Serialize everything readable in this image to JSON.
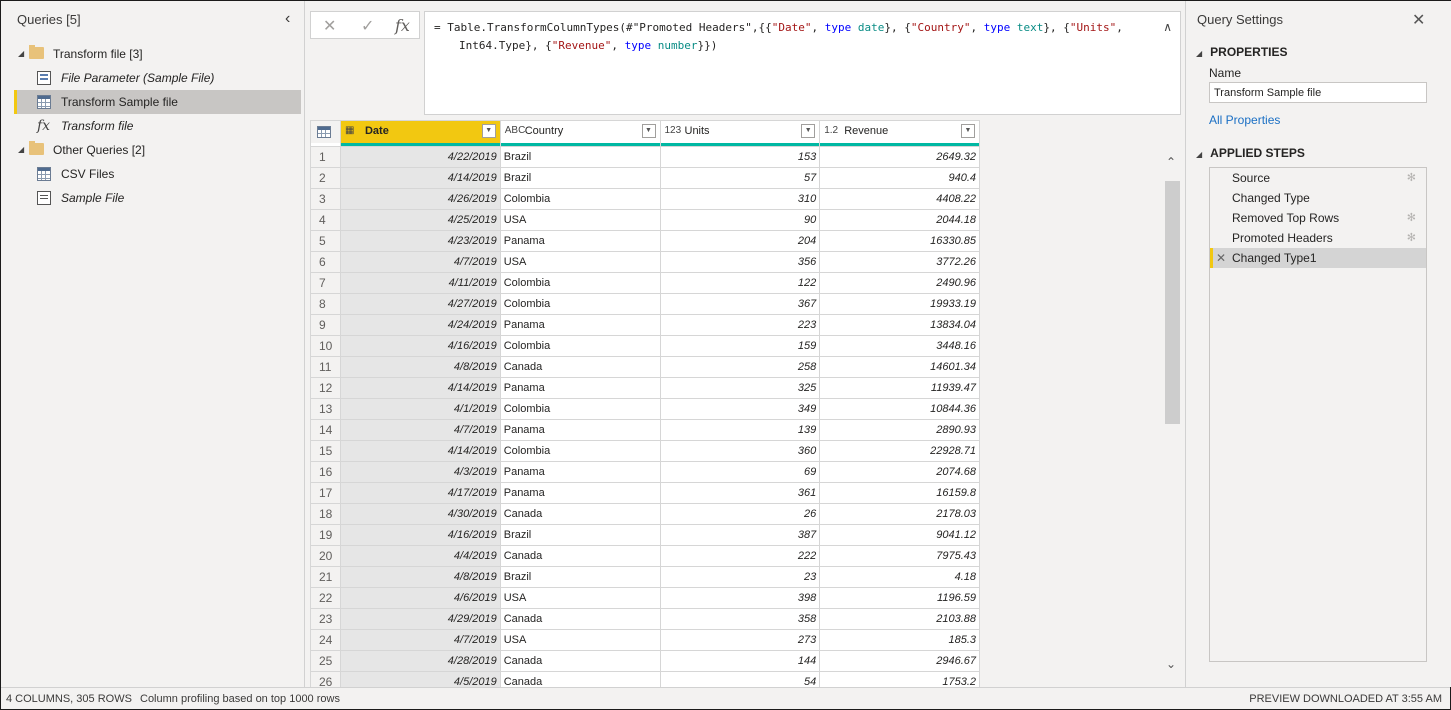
{
  "queries_pane": {
    "title": "Queries [5]",
    "groups": [
      {
        "label": "Transform file [3]",
        "items": [
          {
            "label": "File Parameter (Sample File)",
            "icon": "parameter-icon",
            "italic": true,
            "selected": false
          },
          {
            "label": "Transform Sample file",
            "icon": "table-icon",
            "italic": false,
            "selected": true
          },
          {
            "label": "Transform file",
            "icon": "function-icon",
            "italic": true,
            "selected": false
          }
        ]
      },
      {
        "label": "Other Queries [2]",
        "items": [
          {
            "label": "CSV Files",
            "icon": "table-icon",
            "italic": false,
            "selected": false
          },
          {
            "label": "Sample File",
            "icon": "document-icon",
            "italic": true,
            "selected": false
          }
        ]
      }
    ]
  },
  "formula_bar": {
    "cancel_glyph": "✕",
    "commit_glyph": "✓",
    "fx_glyph": "fx",
    "line1": [
      {
        "t": "= Table.TransformColumnTypes(#",
        "c": ""
      },
      {
        "t": "\"Promoted Headers\"",
        "c": ""
      },
      {
        "t": ",{{",
        "c": ""
      },
      {
        "t": "\"Date\"",
        "c": "str"
      },
      {
        "t": ", ",
        "c": ""
      },
      {
        "t": "type",
        "c": "kw"
      },
      {
        "t": " ",
        "c": ""
      },
      {
        "t": "date",
        "c": "type"
      },
      {
        "t": "}, {",
        "c": ""
      },
      {
        "t": "\"Country\"",
        "c": "str"
      },
      {
        "t": ", ",
        "c": ""
      },
      {
        "t": "type",
        "c": "kw"
      },
      {
        "t": " ",
        "c": ""
      },
      {
        "t": "text",
        "c": "type"
      },
      {
        "t": "}, {",
        "c": ""
      },
      {
        "t": "\"Units\"",
        "c": "str"
      },
      {
        "t": ",",
        "c": ""
      }
    ],
    "line2": [
      {
        "t": "Int64.Type}, {",
        "c": ""
      },
      {
        "t": "\"Revenue\"",
        "c": "str"
      },
      {
        "t": ", ",
        "c": ""
      },
      {
        "t": "type",
        "c": "kw"
      },
      {
        "t": " ",
        "c": ""
      },
      {
        "t": "number",
        "c": "type"
      },
      {
        "t": "}})",
        "c": ""
      }
    ]
  },
  "grid": {
    "columns": [
      {
        "name": "Date",
        "type_icon": "▦",
        "selected": true
      },
      {
        "name": "Country",
        "type_icon": "ABC",
        "selected": false
      },
      {
        "name": "Units",
        "type_icon": "123",
        "selected": false
      },
      {
        "name": "Revenue",
        "type_icon": "1.2",
        "selected": false
      }
    ],
    "rows": [
      [
        "4/22/2019",
        "Brazil",
        "153",
        "2649.32"
      ],
      [
        "4/14/2019",
        "Brazil",
        "57",
        "940.4"
      ],
      [
        "4/26/2019",
        "Colombia",
        "310",
        "4408.22"
      ],
      [
        "4/25/2019",
        "USA",
        "90",
        "2044.18"
      ],
      [
        "4/23/2019",
        "Panama",
        "204",
        "16330.85"
      ],
      [
        "4/7/2019",
        "USA",
        "356",
        "3772.26"
      ],
      [
        "4/11/2019",
        "Colombia",
        "122",
        "2490.96"
      ],
      [
        "4/27/2019",
        "Colombia",
        "367",
        "19933.19"
      ],
      [
        "4/24/2019",
        "Panama",
        "223",
        "13834.04"
      ],
      [
        "4/16/2019",
        "Colombia",
        "159",
        "3448.16"
      ],
      [
        "4/8/2019",
        "Canada",
        "258",
        "14601.34"
      ],
      [
        "4/14/2019",
        "Panama",
        "325",
        "11939.47"
      ],
      [
        "4/1/2019",
        "Colombia",
        "349",
        "10844.36"
      ],
      [
        "4/7/2019",
        "Panama",
        "139",
        "2890.93"
      ],
      [
        "4/14/2019",
        "Colombia",
        "360",
        "22928.71"
      ],
      [
        "4/3/2019",
        "Panama",
        "69",
        "2074.68"
      ],
      [
        "4/17/2019",
        "Panama",
        "361",
        "16159.8"
      ],
      [
        "4/30/2019",
        "Canada",
        "26",
        "2178.03"
      ],
      [
        "4/16/2019",
        "Brazil",
        "387",
        "9041.12"
      ],
      [
        "4/4/2019",
        "Canada",
        "222",
        "7975.43"
      ],
      [
        "4/8/2019",
        "Brazil",
        "23",
        "4.18"
      ],
      [
        "4/6/2019",
        "USA",
        "398",
        "1196.59"
      ],
      [
        "4/29/2019",
        "Canada",
        "358",
        "2103.88"
      ],
      [
        "4/7/2019",
        "USA",
        "273",
        "185.3"
      ],
      [
        "4/28/2019",
        "Canada",
        "144",
        "2946.67"
      ],
      [
        "4/5/2019",
        "Canada",
        "54",
        "1753.2"
      ]
    ]
  },
  "settings": {
    "title": "Query Settings",
    "properties_header": "PROPERTIES",
    "name_label": "Name",
    "name_value": "Transform Sample file",
    "all_properties": "All Properties",
    "steps_header": "APPLIED STEPS",
    "steps": [
      {
        "label": "Source",
        "gear": true,
        "selected": false
      },
      {
        "label": "Changed Type",
        "gear": false,
        "selected": false
      },
      {
        "label": "Removed Top Rows",
        "gear": true,
        "selected": false
      },
      {
        "label": "Promoted Headers",
        "gear": true,
        "selected": false
      },
      {
        "label": "Changed Type1",
        "gear": false,
        "selected": true
      }
    ]
  },
  "status": {
    "columns_rows": "4 COLUMNS, 305 ROWS",
    "profiling": "Column profiling based on top 1000 rows",
    "preview": "PREVIEW DOWNLOADED AT 3:55 AM"
  },
  "colors": {
    "accent_yellow": "#f2c811",
    "quality_bar": "#00b8a3",
    "link": "#1a6fc4"
  }
}
